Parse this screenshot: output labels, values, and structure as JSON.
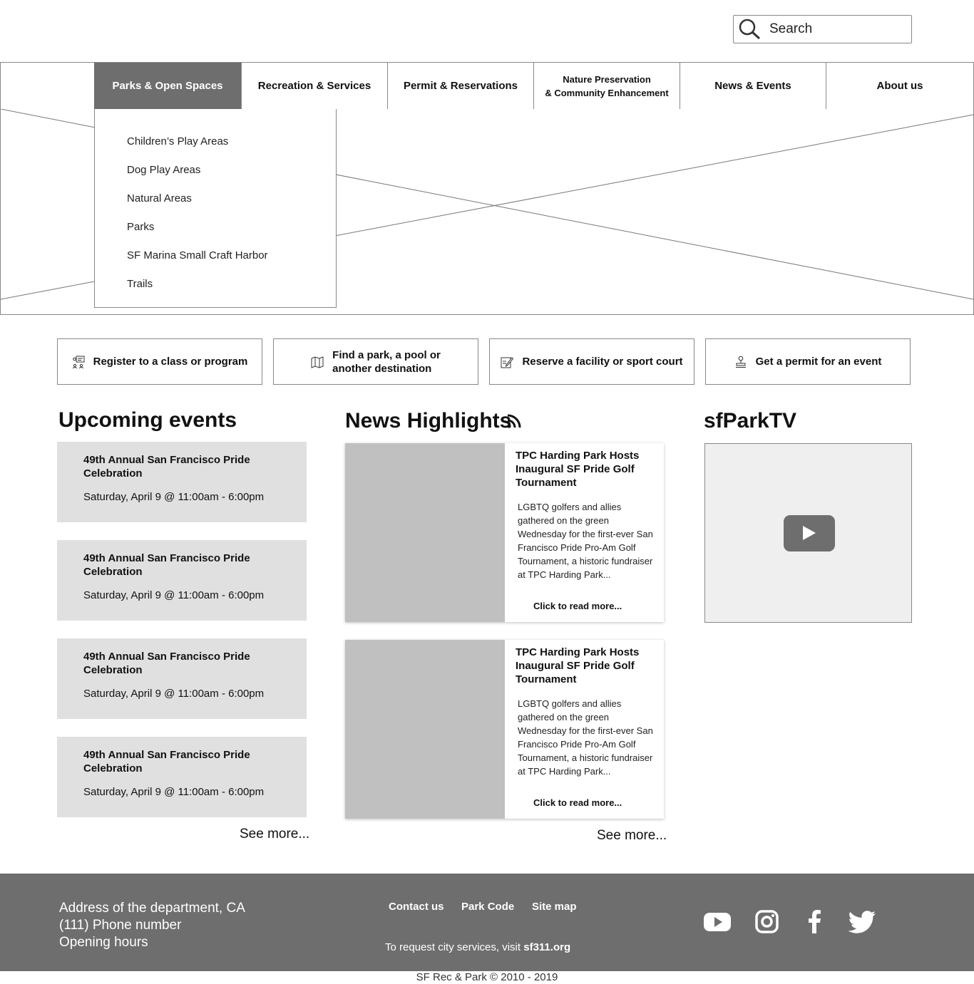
{
  "search": {
    "placeholder": "Search",
    "icon": "search-icon"
  },
  "nav": {
    "items": [
      {
        "label": "Parks & Open Spaces"
      },
      {
        "label": "Recreation & Services"
      },
      {
        "label": "Permit & Reservations"
      },
      {
        "label_line1": "Nature Preservation",
        "label_line2": "& Community Enhancement"
      },
      {
        "label": "News & Events"
      },
      {
        "label": "About us"
      }
    ]
  },
  "dropdown": {
    "items": [
      "Children’s Play Areas",
      "Dog Play Areas",
      "Natural Areas",
      "Parks",
      "SF Marina Small Craft Harbor",
      "Trails"
    ]
  },
  "quick_actions": [
    {
      "label": "Register to a class or program",
      "icon": "class-register-icon"
    },
    {
      "label_line1": "Find a park,  a pool or",
      "label_line2": "another destination",
      "icon": "map-icon"
    },
    {
      "label": "Reserve a facility or sport court",
      "icon": "edit-form-icon"
    },
    {
      "label": "Get a permit for an event",
      "icon": "stamp-icon"
    }
  ],
  "events": {
    "heading": "Upcoming events",
    "items": [
      {
        "title": "49th Annual San Francisco Pride Celebration",
        "date": "Saturday, April 9 @ 11:00am - 6:00pm"
      },
      {
        "title": "49th Annual San Francisco Pride Celebration",
        "date": "Saturday, April 9 @ 11:00am - 6:00pm"
      },
      {
        "title": "49th Annual San Francisco Pride Celebration",
        "date": "Saturday, April 9 @ 11:00am - 6:00pm"
      },
      {
        "title": "49th Annual San Francisco Pride Celebration",
        "date": "Saturday, April 9 @ 11:00am - 6:00pm"
      }
    ],
    "see_more": "See more..."
  },
  "news": {
    "heading": "News Highlights",
    "items": [
      {
        "title": "TPC Harding Park Hosts Inaugural SF Pride Golf Tournament",
        "body": "LGBTQ golfers and allies gathered on the green Wednesday for the first-ever San Francisco Pride Pro-Am Golf Tournament, a historic fundraiser at TPC Harding Park...",
        "more": "Click to read more..."
      },
      {
        "title": "TPC Harding Park Hosts Inaugural SF Pride Golf Tournament",
        "body": "LGBTQ golfers and allies gathered on the green Wednesday for the first-ever San Francisco Pride Pro-Am Golf Tournament, a historic fundraiser at TPC Harding Park...",
        "more": "Click to read more..."
      }
    ],
    "see_more": "See more..."
  },
  "tv": {
    "heading": "sfParkTV"
  },
  "footer": {
    "address": "Address of the department, CA",
    "phone": "(111) Phone number",
    "hours": "Opening hours",
    "links": [
      "Contact us",
      "Park Code",
      "Site map"
    ],
    "request_text": "To request city services, visit ",
    "request_link": "sf311.org",
    "social": [
      "youtube-icon",
      "instagram-icon",
      "facebook-icon",
      "twitter-icon"
    ]
  },
  "copyright": "SF Rec & Park © 2010 - 2019",
  "colors": {
    "nav_active": "#6e6e6e",
    "footer_bg": "#6e6e6e",
    "event_bg": "#e0e0e0",
    "news_img": "#c0c0c0"
  }
}
